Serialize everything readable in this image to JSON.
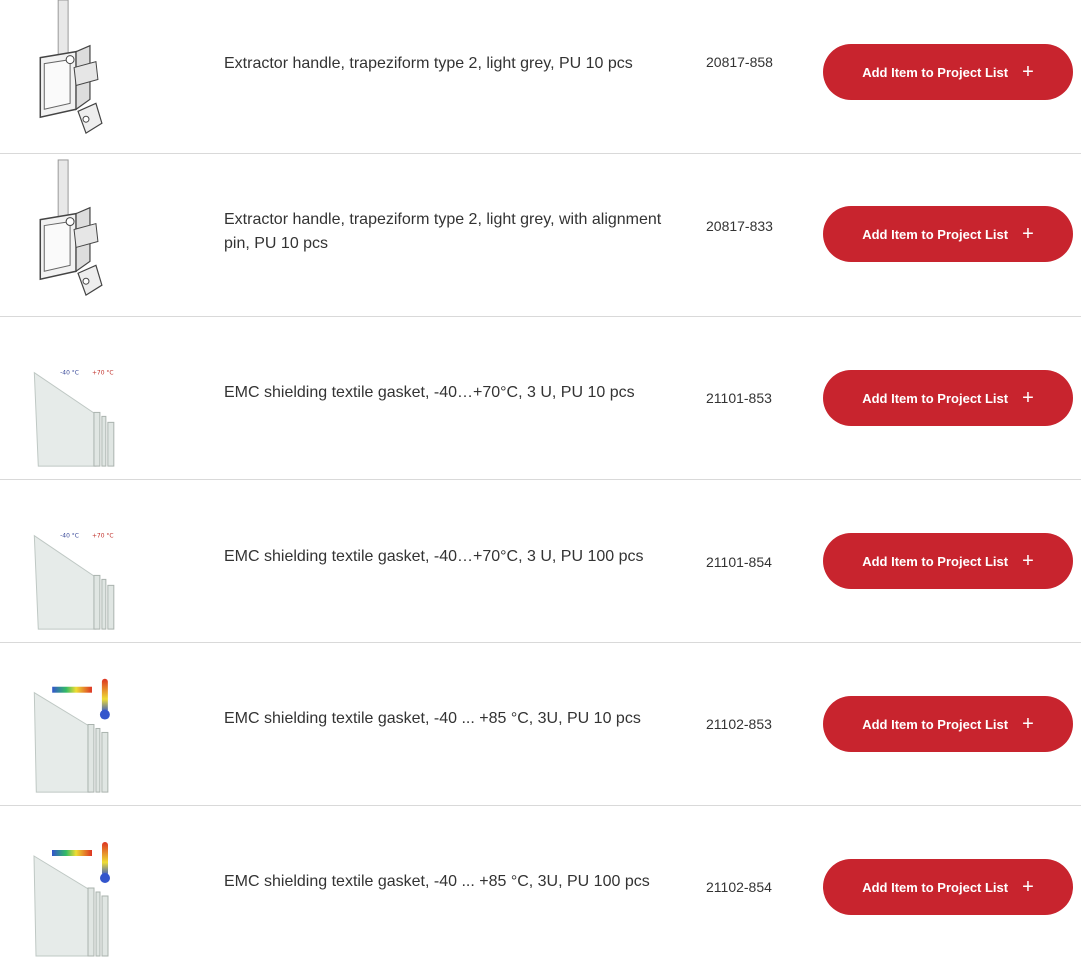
{
  "colors": {
    "accent": "#c8242e",
    "divider": "#d9d9d9",
    "text": "#333333"
  },
  "items": [
    {
      "thumb_icon": "extractor-handle-image",
      "description": "Extractor handle, trapeziform type 2, light grey, PU 10 pcs",
      "art_no": "20817-858",
      "button_label": "Add Item to Project List",
      "button_icon": "plus-icon",
      "plus": "+"
    },
    {
      "thumb_icon": "extractor-handle-image",
      "description": "Extractor handle, trapeziform type 2, light grey, with alignment pin, PU 10 pcs",
      "art_no": "20817-833",
      "button_label": "Add Item to Project List",
      "button_icon": "plus-icon",
      "plus": "+"
    },
    {
      "thumb_icon": "gasket-70-image",
      "thumb_label_left": "-40 °C",
      "thumb_label_right": "+70 °C",
      "description": "EMC shielding textile gasket, -40…+70°C, 3 U, PU 10 pcs",
      "art_no": "21101-853",
      "button_label": "Add Item to Project List",
      "button_icon": "plus-icon",
      "plus": "+"
    },
    {
      "thumb_icon": "gasket-70-image",
      "thumb_label_left": "-40 °C",
      "thumb_label_right": "+70 °C",
      "description": "EMC shielding textile gasket, -40…+70°C, 3 U, PU 100 pcs",
      "art_no": "21101-854",
      "button_label": "Add Item to Project List",
      "button_icon": "plus-icon",
      "plus": "+"
    },
    {
      "thumb_icon": "gasket-85-thermometer-image",
      "description": "EMC shielding textile gasket, -40 ... +85 °C, 3U, PU 10 pcs",
      "art_no": "21102-853",
      "button_label": "Add Item to Project List",
      "button_icon": "plus-icon",
      "plus": "+"
    },
    {
      "thumb_icon": "gasket-85-thermometer-image",
      "description": "EMC shielding textile gasket, -40 ... +85 °C, 3U, PU 100 pcs",
      "art_no": "21102-854",
      "button_label": "Add Item to Project List",
      "button_icon": "plus-icon",
      "plus": "+"
    }
  ]
}
